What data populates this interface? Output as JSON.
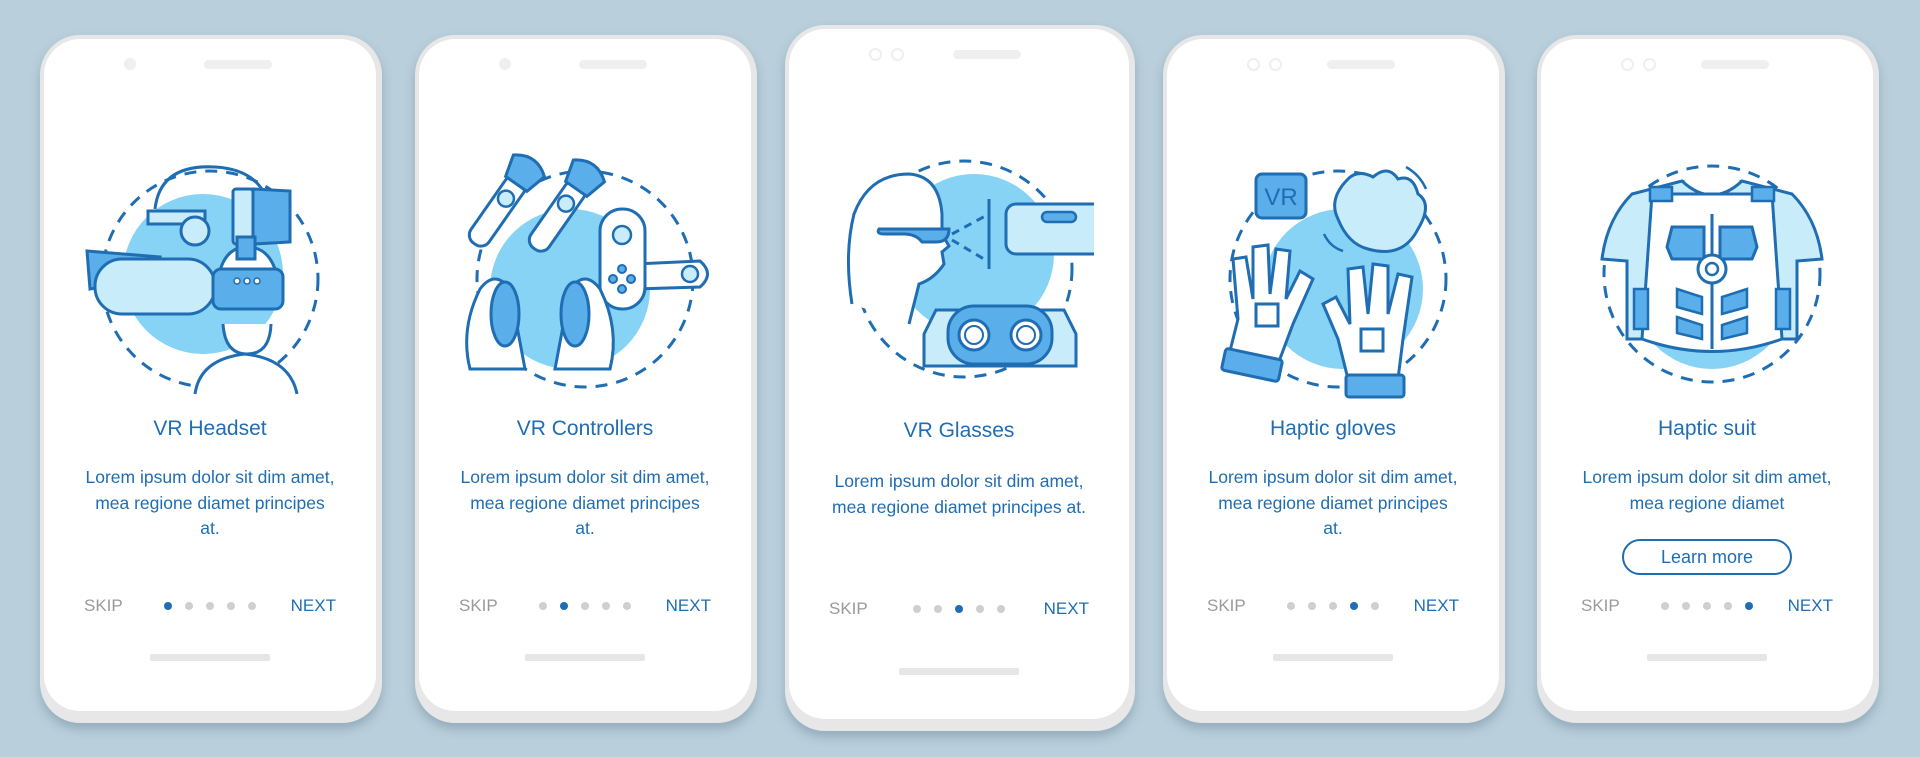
{
  "colors": {
    "background": "#b9cfdb",
    "accent": "#1f6db3",
    "illustration_light": "#c9ecfb",
    "illustration_mid": "#86d3f5",
    "illustration_dark": "#5aaeea",
    "inactive_dot": "#cfcfcf",
    "skip_text": "#9a9a9a"
  },
  "screens": [
    {
      "title": "VR Headset",
      "description": "Lorem ipsum dolor sit dim amet, mea regione diamet principes at.",
      "illustration_icon": "vr-headset-icon",
      "skip_label": "SKIP",
      "next_label": "NEXT",
      "active_page": 1,
      "total_pages": 5
    },
    {
      "title": "VR Controllers",
      "description": "Lorem ipsum dolor sit dim amet, mea regione diamet principes at.",
      "illustration_icon": "vr-controllers-icon",
      "skip_label": "SKIP",
      "next_label": "NEXT",
      "active_page": 2,
      "total_pages": 5
    },
    {
      "title": "VR Glasses",
      "description": "Lorem ipsum dolor sit dim amet, mea regione diamet principes at.",
      "illustration_icon": "vr-glasses-icon",
      "skip_label": "SKIP",
      "next_label": "NEXT",
      "active_page": 3,
      "total_pages": 5
    },
    {
      "title": "Haptic gloves",
      "description": "Lorem ipsum dolor sit dim amet, mea regione diamet principes at.",
      "illustration_icon": "haptic-gloves-icon",
      "illustration_badge": "VR",
      "skip_label": "SKIP",
      "next_label": "NEXT",
      "active_page": 4,
      "total_pages": 5
    },
    {
      "title": "Haptic suit",
      "description": "Lorem ipsum dolor sit dim amet, mea regione diamet",
      "illustration_icon": "haptic-suit-icon",
      "button_label": "Learn more",
      "skip_label": "SKIP",
      "next_label": "NEXT",
      "active_page": 5,
      "total_pages": 5
    }
  ]
}
